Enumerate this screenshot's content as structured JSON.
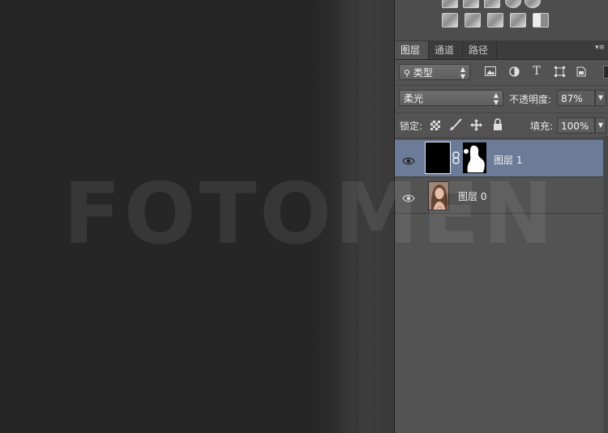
{
  "layers_panel": {
    "tabs": [
      {
        "label": "图层",
        "active": true
      },
      {
        "label": "通道",
        "active": false
      },
      {
        "label": "路径",
        "active": false
      }
    ],
    "filter": {
      "value": "类型"
    },
    "blend_mode": {
      "value": "柔光"
    },
    "opacity": {
      "label": "不透明度:",
      "value": "87%"
    },
    "lock": {
      "label": "锁定:"
    },
    "fill": {
      "label": "填充:",
      "value": "100%"
    },
    "layers": [
      {
        "name": "图层 1",
        "selected": true,
        "visible": true,
        "has_mask": true
      },
      {
        "name": "图层 0",
        "selected": false,
        "visible": true,
        "has_mask": false
      }
    ]
  },
  "watermark": {
    "text": "FOTOMEN"
  },
  "colors": {
    "panel_bg": "#535353",
    "selected_row": "#6c7b97",
    "canvas_bg": "#262626"
  },
  "icons": {
    "filter_type_icons": [
      "image-filter-icon",
      "adjustment-filter-icon",
      "type-filter-icon",
      "shape-filter-icon",
      "smart-object-filter-icon"
    ],
    "lock_icons": [
      "lock-transparent-pixels-icon",
      "lock-image-pixels-icon",
      "lock-position-icon",
      "lock-all-icon"
    ]
  }
}
